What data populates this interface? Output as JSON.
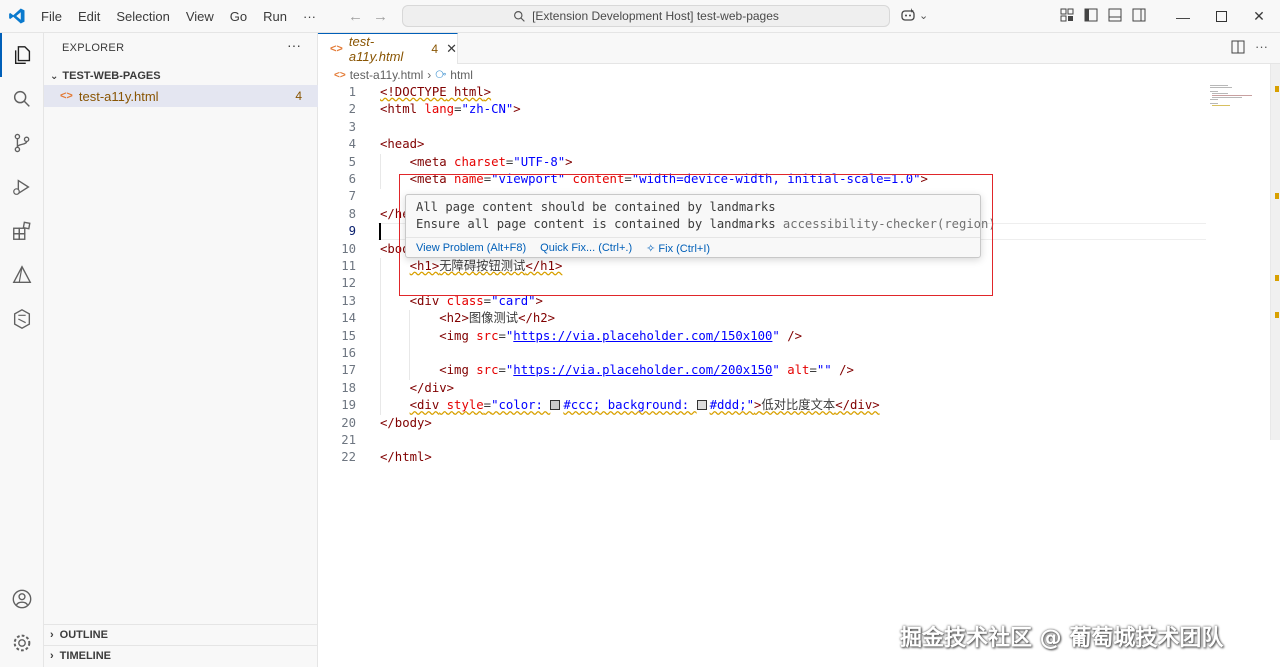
{
  "titlebar": {
    "menu": [
      "File",
      "Edit",
      "Selection",
      "View",
      "Go",
      "Run",
      "···"
    ],
    "search_text": "[Extension Development Host] test-web-pages"
  },
  "explorer": {
    "title": "EXPLORER",
    "more": "···",
    "folder": "TEST-WEB-PAGES",
    "file": {
      "name": "test-a11y.html",
      "badge": "4"
    },
    "sections": [
      "OUTLINE",
      "TIMELINE"
    ]
  },
  "editor": {
    "tab": {
      "name": "test-a11y.html",
      "badge": "4"
    },
    "breadcrumb": {
      "file": "test-a11y.html",
      "symbol": "html"
    },
    "line_numbers": [
      "1",
      "2",
      "3",
      "4",
      "5",
      "6",
      "7",
      "8",
      "9",
      "10",
      "11",
      "12",
      "13",
      "14",
      "15",
      "16",
      "17",
      "18",
      "19",
      "20",
      "21",
      "22"
    ],
    "current_line": "9"
  },
  "code": {
    "l1_a": "<!DOCTYPE",
    "l1_b": " html",
    "l1_c": ">",
    "l2_a": "<html",
    "l2_b": " lang",
    "l2_c": "=",
    "l2_d": "\"zh-CN\"",
    "l2_e": ">",
    "l4": "<head>",
    "l5_a": "<meta",
    "l5_b": " charset",
    "l5_c": "=",
    "l5_d": "\"UTF-8\"",
    "l5_e": ">",
    "l6_a": "<meta",
    "l6_b": " name",
    "l6_c": "=",
    "l6_d": "\"viewport\"",
    "l6_e": " content",
    "l6_f": "=",
    "l6_g": "\"width=device-width, initial-scale=1.0\"",
    "l6_h": ">",
    "l8": "</he",
    "l10": "<bod",
    "l11_a": "<h1>",
    "l11_b": "无障碍按钮测试",
    "l11_c": "</h1>",
    "l13_a": "<div",
    "l13_b": " class",
    "l13_c": "=",
    "l13_d": "\"card\"",
    "l13_e": ">",
    "l14_a": "<h2>",
    "l14_b": "图像测试",
    "l14_c": "</h2>",
    "l15_a": "<img",
    "l15_b": " src",
    "l15_c": "=",
    "l15_d": "\"",
    "l15_e": "https://via.placeholder.com/150x100",
    "l15_f": "\"",
    "l15_g": " />",
    "l17_a": "<img",
    "l17_b": " src",
    "l17_c": "=",
    "l17_d": "\"",
    "l17_e": "https://via.placeholder.com/200x150",
    "l17_f": "\"",
    "l17_g": " alt",
    "l17_h": "=",
    "l17_i": "\"\"",
    "l17_j": " />",
    "l18": "</div>",
    "l19_a": "<div",
    "l19_b": " style",
    "l19_c": "=",
    "l19_d": "\"color: ",
    "l19_e": "#ccc; background: ",
    "l19_f": "#ddd;\"",
    "l19_g": ">",
    "l19_h": "低对比度文本",
    "l19_i": "</div>",
    "l20": "</body>",
    "l22": "</html>"
  },
  "hover": {
    "line1": "All page content should be contained by landmarks",
    "line2": "Ensure all page content is contained by landmarks",
    "source": "accessibility-checker(region)",
    "action_view": "View Problem (Alt+F8)",
    "action_quickfix": "Quick Fix... (Ctrl+.)",
    "action_fix": "Fix (Ctrl+I)"
  },
  "colors": {
    "accent": "#005fb8",
    "warning": "#d8a000",
    "highlight_box": "#e0262a",
    "tag": "#800000",
    "attr": "#e50000",
    "value": "#0000ff"
  },
  "watermark": "掘金技术社区 @ 葡萄城技术团队"
}
